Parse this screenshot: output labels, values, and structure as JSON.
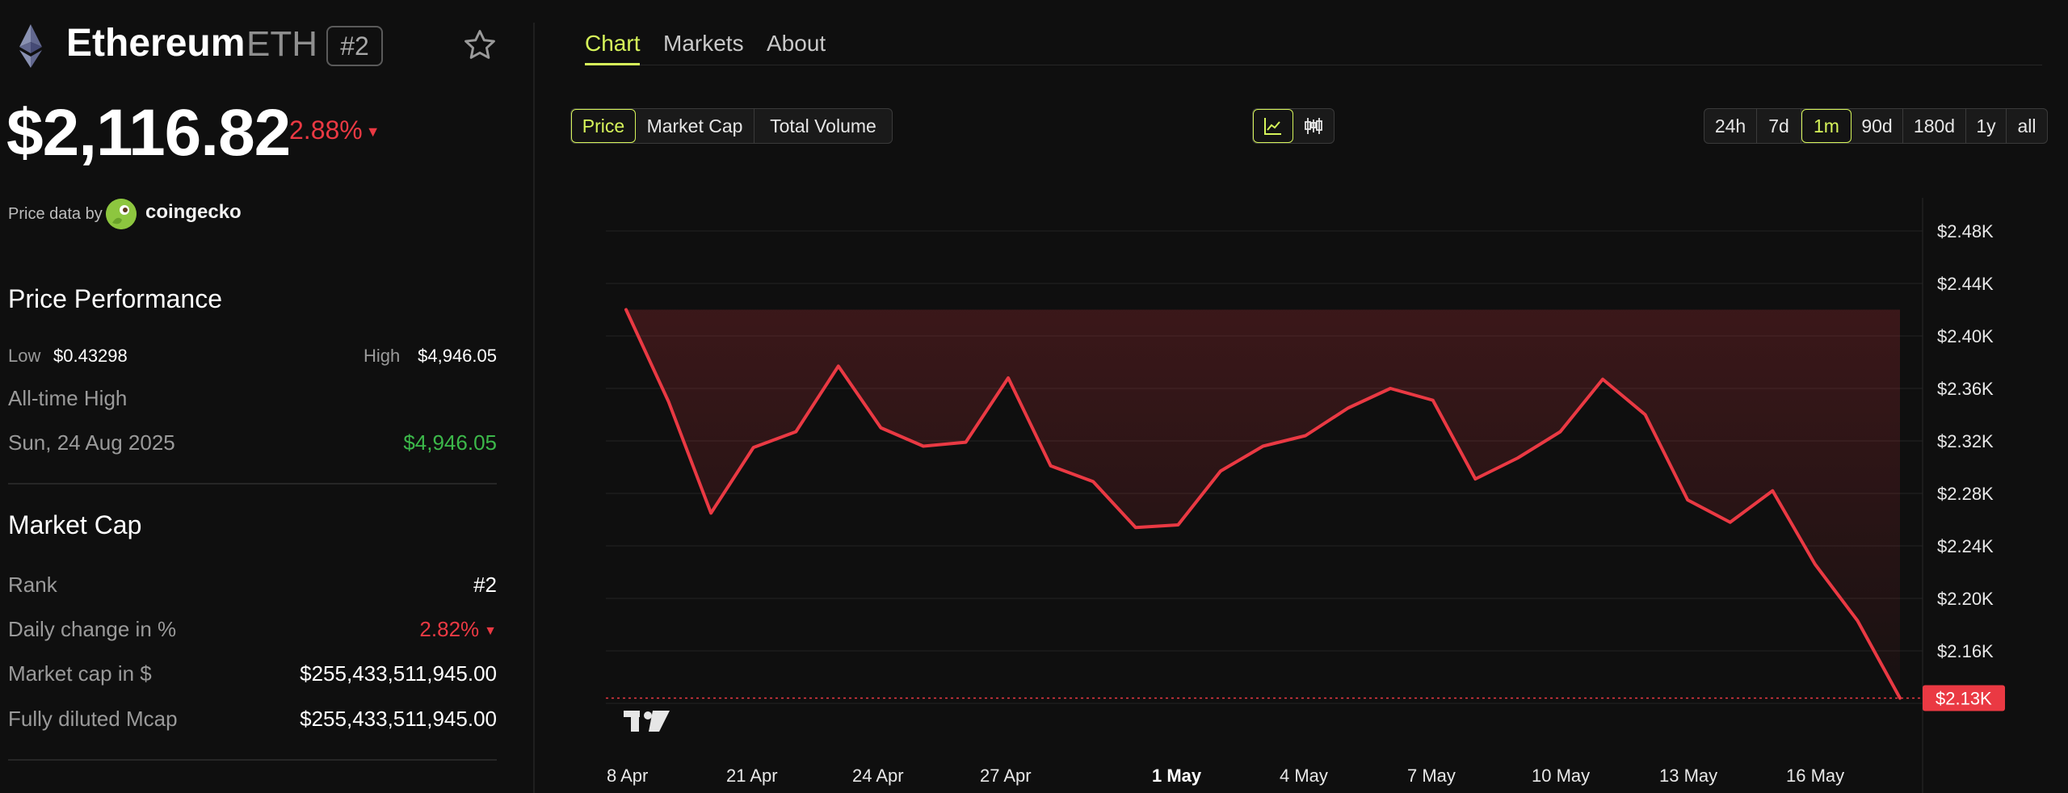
{
  "coin": {
    "name": "Ethereum",
    "symbol": "ETH",
    "rank_badge": "#2",
    "price": "$2,116.82",
    "change": "2.88%",
    "change_arrow": "▼"
  },
  "source": {
    "label": "Price data by",
    "name": "coingecko"
  },
  "performance": {
    "title": "Price Performance",
    "low_label": "Low",
    "low_value": "$0.43298",
    "high_label": "High",
    "high_value": "$4,946.05",
    "ath_label": "All-time High",
    "ath_date": "Sun, 24 Aug 2025",
    "ath_value": "$4,946.05"
  },
  "market_cap": {
    "title": "Market Cap",
    "rows": [
      {
        "label": "Rank",
        "value": "#2"
      },
      {
        "label": "Daily change in %",
        "value": "2.82%",
        "arrow": "▼"
      },
      {
        "label": "Market cap in $",
        "value": "$255,433,511,945.00"
      },
      {
        "label": "Fully diluted Mcap",
        "value": "$255,433,511,945.00"
      }
    ]
  },
  "tabs": [
    "Chart",
    "Markets",
    "About"
  ],
  "active_tab": "Chart",
  "metric_buttons": [
    "Price",
    "Market Cap",
    "Total Volume"
  ],
  "active_metric": "Price",
  "chart_styles": [
    "line-chart-icon",
    "candlestick-icon"
  ],
  "ranges": [
    "24h",
    "7d",
    "1m",
    "90d",
    "180d",
    "1y",
    "all"
  ],
  "active_range": "1m",
  "colors": {
    "accent": "#d6f45a",
    "down": "#ea3943",
    "up": "#3cb84a",
    "background": "#0f0f0f"
  },
  "chart_data": {
    "type": "area",
    "x_tick_labels": [
      "8 Apr",
      "21 Apr",
      "24 Apr",
      "27 Apr",
      "1 May",
      "4 May",
      "7 May",
      "10 May",
      "13 May",
      "16 May"
    ],
    "x_tick_bold": "1 May",
    "y_tick_labels": [
      "$2.48K",
      "$2.44K",
      "$2.40K",
      "$2.36K",
      "$2.32K",
      "$2.28K",
      "$2.24K",
      "$2.20K",
      "$2.16K"
    ],
    "y_ticks": [
      2480,
      2440,
      2400,
      2360,
      2320,
      2280,
      2240,
      2200,
      2160
    ],
    "ylim": [
      2110,
      2500
    ],
    "current_label": "$2.13K",
    "current_value": 2124,
    "grid": true,
    "series": [
      {
        "values": [
          2420,
          2350,
          2265,
          2315,
          2327,
          2377,
          2330,
          2316,
          2319,
          2368,
          2301,
          2289,
          2254,
          2256,
          2297,
          2316,
          2324,
          2345,
          2360,
          2351,
          2291,
          2307,
          2327,
          2367,
          2340,
          2275,
          2258,
          2282,
          2226,
          2183,
          2124
        ]
      }
    ]
  }
}
